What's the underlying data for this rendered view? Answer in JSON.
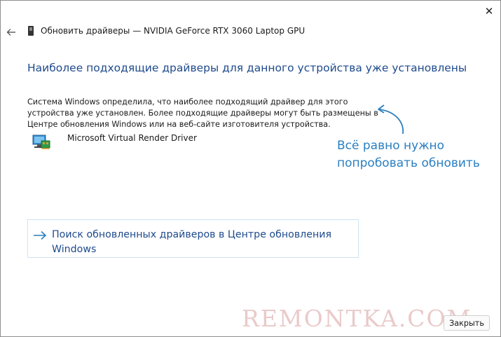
{
  "window": {
    "title": "Обновить драйверы — NVIDIA GeForce RTX 3060 Laptop GPU",
    "close_glyph": "✕",
    "back_icon": "back-arrow-icon"
  },
  "main": {
    "heading": "Наиболее подходящие драйверы для данного устройства уже установлены",
    "description": "Система Windows определила, что наиболее подходящий драйвер для этого устройства уже установлен. Более подходящие драйверы могут быть размещены в Центре обновления Windows или на веб-сайте изготовителя устройства.",
    "driver_name": "Microsoft Virtual Render Driver",
    "driver_icon": "display-adapter-icon"
  },
  "annotation": {
    "text": "Всё равно нужно попробовать обновить",
    "color": "#2a7fc1"
  },
  "link": {
    "label": "Поиск обновленных драйверов в Центре обновления Windows",
    "arrow_glyph": "→"
  },
  "footer": {
    "close_label": "Закрыть"
  },
  "watermark": {
    "text": "REMONTKA.COM"
  },
  "colors": {
    "heading": "#1e4a8c",
    "accent": "#2a7fc1"
  }
}
